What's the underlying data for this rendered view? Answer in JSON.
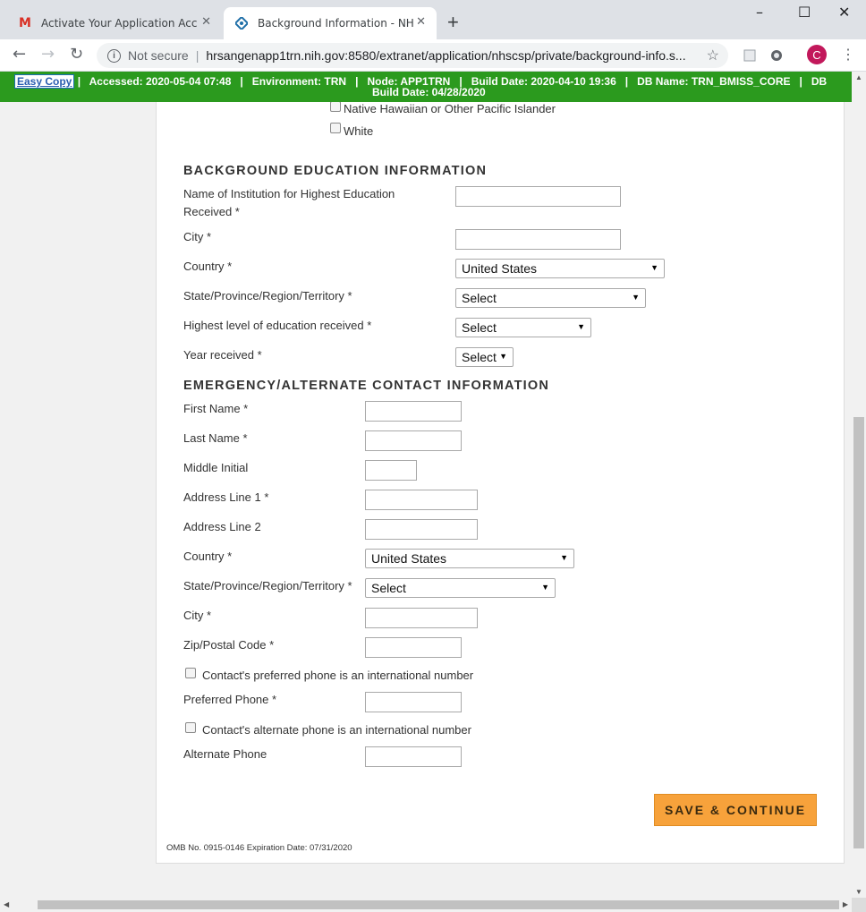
{
  "browser": {
    "tabs": [
      {
        "title": "Activate Your Application Accou",
        "favicon": "gmail-icon"
      },
      {
        "title": "Background Information - NHSC",
        "favicon": "nhsc-icon"
      }
    ],
    "security_label": "Not secure",
    "url": "hrsangenapp1trn.nih.gov:8580/extranet/application/nhscsp/private/background-info.s...",
    "profile_initial": "C"
  },
  "envbar": {
    "easy_copy": "Easy Copy",
    "line1": "|   Accessed: 2020-05-04 07:48   |   Environment: TRN   |   Node: APP1TRN   |   Build Date: 2020-04-10 19:36   |   DB Name: TRN_BMISS_CORE   |   DB",
    "line2": "Build Date: 04/28/2020"
  },
  "race": {
    "options": [
      "Native Hawaiian or Other Pacific Islander",
      "White"
    ]
  },
  "education": {
    "heading": "BACKGROUND EDUCATION INFORMATION",
    "institution_label_1": "Name of Institution for Highest Education",
    "institution_label_2": "Received *",
    "city_label": "City *",
    "country_label": "Country *",
    "country_value": "United States",
    "state_label": "State/Province/Region/Territory *",
    "state_value": "Select",
    "level_label": "Highest level of education received *",
    "level_value": "Select",
    "year_label": "Year received *",
    "year_value": "Select"
  },
  "emergency": {
    "heading": "EMERGENCY/ALTERNATE CONTACT INFORMATION",
    "first_name_label": "First Name *",
    "last_name_label": "Last Name *",
    "middle_initial_label": "Middle Initial",
    "address1_label": "Address Line 1 *",
    "address2_label": "Address Line 2",
    "country_label": "Country *",
    "country_value": "United States",
    "state_label": "State/Province/Region/Territory *",
    "state_value": "Select",
    "city_label": "City *",
    "zip_label": "Zip/Postal Code *",
    "intl_preferred_label": "Contact's preferred phone is an international number",
    "preferred_phone_label": "Preferred Phone *",
    "intl_alternate_label": "Contact's alternate phone is an international number",
    "alternate_phone_label": "Alternate Phone"
  },
  "actions": {
    "save_label": "SAVE & CONTINUE"
  },
  "footer": {
    "omb": "OMB No. 0915-0146 Expiration Date: 07/31/2020"
  },
  "colors": {
    "env_bar": "#2b9a1e",
    "save_button": "#f7a23b"
  }
}
